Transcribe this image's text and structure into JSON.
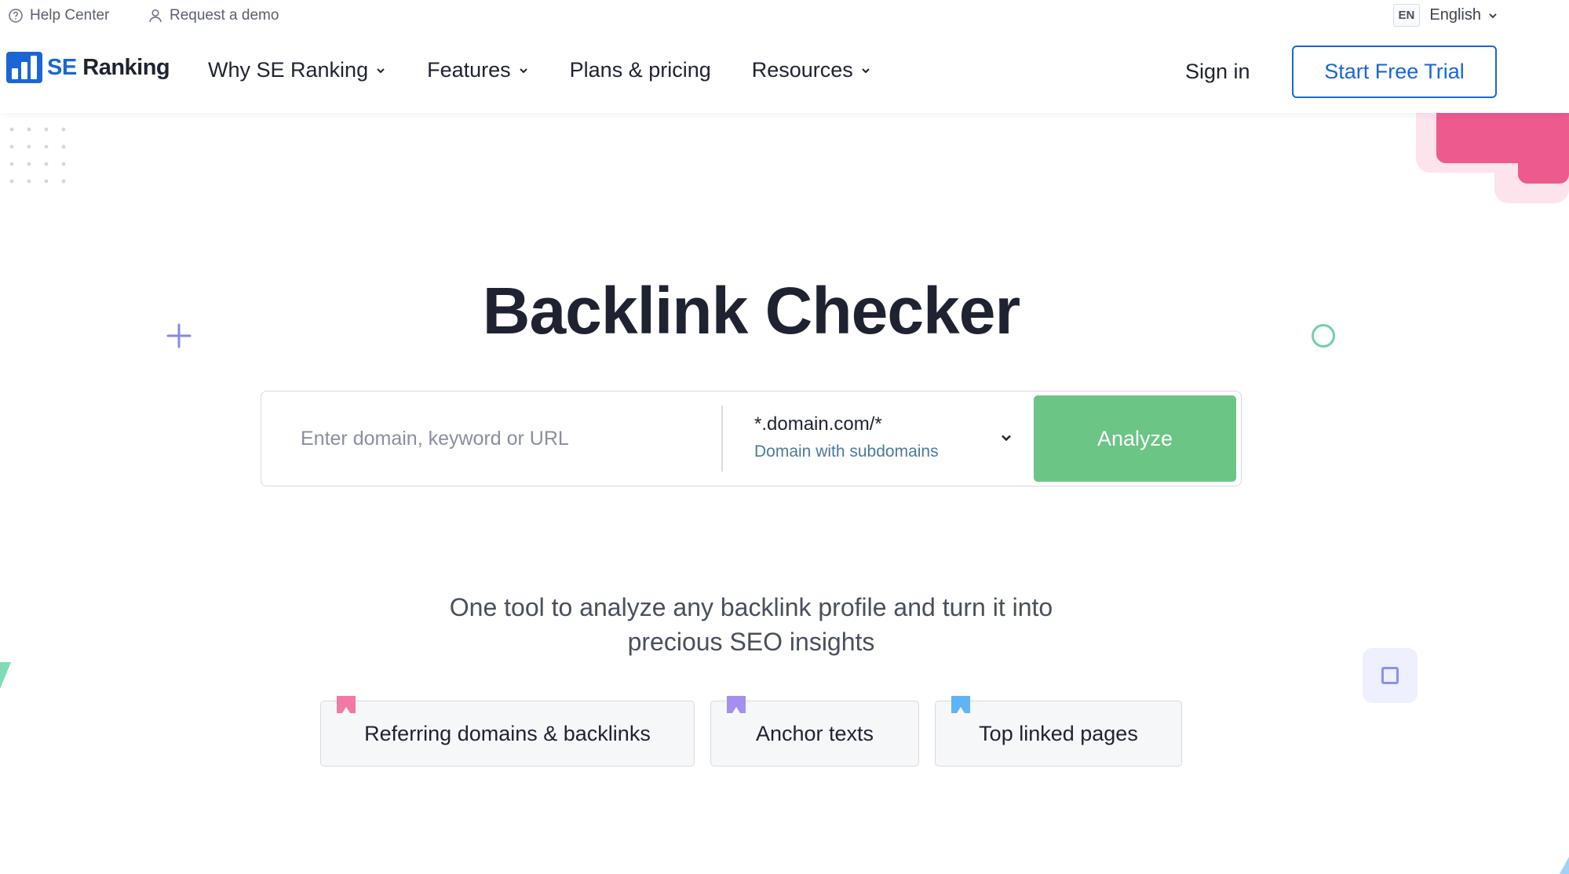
{
  "utility": {
    "help_center": "Help Center",
    "request_demo": "Request a demo",
    "lang_code": "EN",
    "lang_name": "English"
  },
  "nav": {
    "logo_se": "SE",
    "logo_ranking": "Ranking",
    "items": [
      {
        "label": "Why SE Ranking",
        "has_dropdown": true
      },
      {
        "label": "Features",
        "has_dropdown": true
      },
      {
        "label": "Plans & pricing",
        "has_dropdown": false
      },
      {
        "label": "Resources",
        "has_dropdown": true
      }
    ],
    "sign_in": "Sign in",
    "trial_button": "Start Free Trial"
  },
  "hero": {
    "title": "Backlink Checker",
    "search": {
      "placeholder": "Enter domain, keyword or URL",
      "value": "",
      "scope_value": "*.domain.com/*",
      "scope_description": "Domain with subdomains",
      "analyze_label": "Analyze"
    },
    "subtitle_line1": "One tool to analyze any backlink profile and turn it into",
    "subtitle_line2": "precious SEO insights"
  },
  "feature_tags": [
    {
      "label": "Referring domains & backlinks",
      "marker_color": "#f279a6"
    },
    {
      "label": "Anchor texts",
      "marker_color": "#a48ef0"
    },
    {
      "label": "Top linked pages",
      "marker_color": "#5fb4f5"
    }
  ],
  "colors": {
    "brand_blue": "#1a66d6",
    "analyze_green": "#6bc585",
    "text_dark": "#1f2230",
    "decor_pink": "#ec5a8e",
    "decor_teal": "#6fd1a8",
    "decor_violet": "#8c8ff0"
  },
  "icons": {
    "help": "help-circle-icon",
    "user": "user-icon",
    "chevron": "chevron-down-icon",
    "logo": "se-ranking-logo-icon"
  }
}
